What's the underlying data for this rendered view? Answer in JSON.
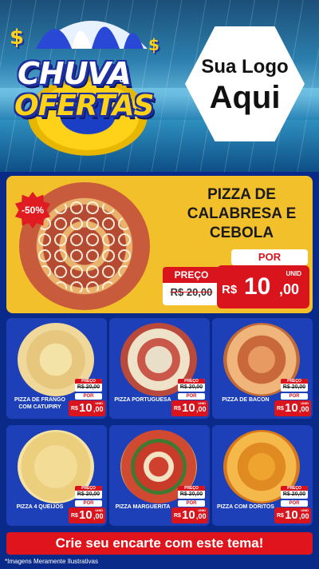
{
  "header": {
    "title_line1": "CHUVA",
    "title_small": "de",
    "title_line2": "OFERTAS",
    "logo_line1": "Sua Logo",
    "logo_line2": "Aqui"
  },
  "featured": {
    "discount_badge": "-50%",
    "name": "PIZZA DE CALABRESA E CEBOLA",
    "por_label": "POR",
    "preco_label": "PREÇO",
    "old_price": "R$ 20,00",
    "currency": "R$",
    "price_int": "10",
    "price_cents": ",00",
    "unit": "UNID"
  },
  "products": [
    {
      "name": "PIZZA DE FRANGO COM CATUPIRY",
      "preco_label": "PREÇO",
      "old_price": "R$ 20,00",
      "por_label": "POR",
      "currency": "R$",
      "price_int": "10",
      "price_cents": ",00",
      "unit": "UNID"
    },
    {
      "name": "PIZZA PORTUGUESA",
      "preco_label": "PREÇO",
      "old_price": "R$ 20,00",
      "por_label": "POR",
      "currency": "R$",
      "price_int": "10",
      "price_cents": ",00",
      "unit": "UNID"
    },
    {
      "name": "PIZZA DE BACON",
      "preco_label": "PREÇO",
      "old_price": "R$ 20,00",
      "por_label": "POR",
      "currency": "R$",
      "price_int": "10",
      "price_cents": ",00",
      "unit": "UNID"
    },
    {
      "name": "PIZZA 4 QUEIJOS",
      "preco_label": "PREÇO",
      "old_price": "R$ 20,00",
      "por_label": "POR",
      "currency": "R$",
      "price_int": "10",
      "price_cents": ",00",
      "unit": "UNID"
    },
    {
      "name": "PIZZA MARGUERITA",
      "preco_label": "PREÇO",
      "old_price": "R$ 20,00",
      "por_label": "POR",
      "currency": "R$",
      "price_int": "10",
      "price_cents": ",00",
      "unit": "UNID"
    },
    {
      "name": "PIZZA COM DORITOS",
      "preco_label": "PREÇO",
      "old_price": "R$ 20,00",
      "por_label": "POR",
      "currency": "R$",
      "price_int": "10",
      "price_cents": ",00",
      "unit": "UNID"
    }
  ],
  "cta": {
    "label": "Crie seu encarte com este tema!"
  },
  "footnote": "*Imagens Meramente Ilustrativas",
  "colors": {
    "accent_red": "#d9141c",
    "gold": "#f2c02a",
    "blue": "#1d3fb8"
  }
}
